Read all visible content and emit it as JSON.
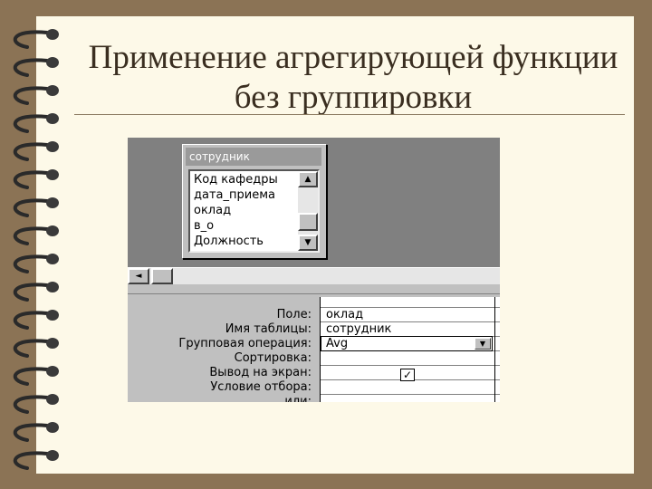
{
  "slide": {
    "title_line1": "Применение агрегирующей функции",
    "title_line2": "без группировки"
  },
  "query_designer": {
    "table_box": {
      "title": "сотрудник",
      "fields": [
        "Код кафедры",
        "дата_приема",
        "оклад",
        "в_о",
        "Должность"
      ]
    },
    "grid_labels": {
      "field": "Поле:",
      "table_name": "Имя таблицы:",
      "group_op": "Групповая операция:",
      "sort": "Сортировка:",
      "show": "Вывод на экран:",
      "criteria": "Условие отбора:",
      "or": "или:"
    },
    "column1": {
      "field": "оклад",
      "table": "сотрудник",
      "group_op": "Avg",
      "show_checked": true,
      "check_mark": "✓"
    }
  },
  "icons": {
    "scroll_up": "▲",
    "scroll_down": "▼",
    "scroll_left": "◄",
    "combo_down": "▼"
  },
  "colors": {
    "background": "#8b7355",
    "page": "#fdf9e8",
    "window_gray": "#c0c0c0",
    "workspace_gray": "#808080"
  }
}
